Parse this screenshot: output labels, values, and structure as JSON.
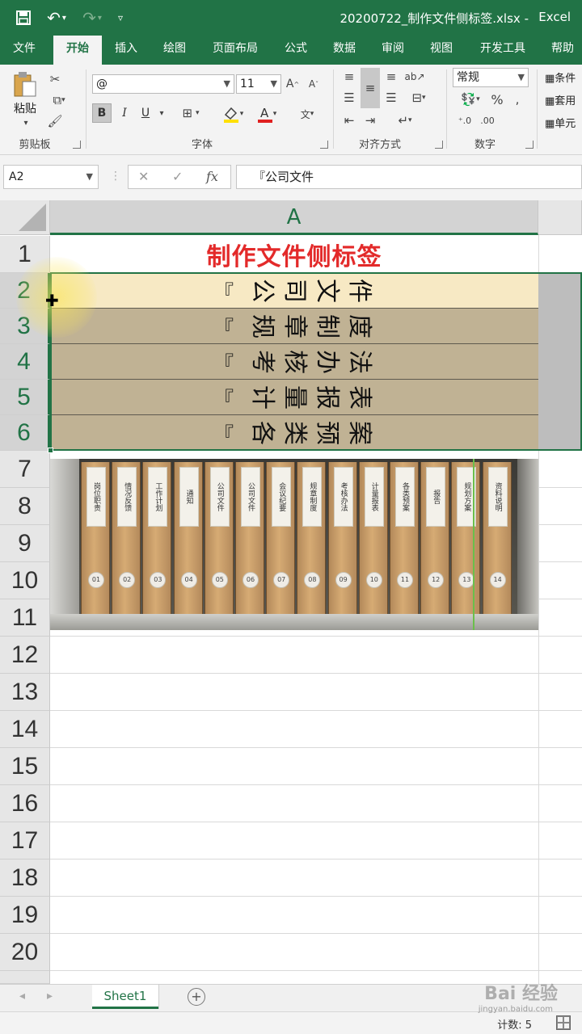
{
  "titlebar": {
    "filename": "20200722_制作文件侧标签.xlsx",
    "separator": "-",
    "app": "Excel",
    "qat": [
      "save-icon",
      "undo-icon",
      "redo-icon",
      "customize-qat-icon"
    ]
  },
  "tabs": [
    "文件",
    "开始",
    "插入",
    "绘图",
    "页面布局",
    "公式",
    "数据",
    "审阅",
    "视图",
    "开发工具",
    "帮助"
  ],
  "active_tab": "开始",
  "ribbon": {
    "clipboard": {
      "paste_label": "粘贴",
      "group_label": "剪贴板"
    },
    "font": {
      "name": "@",
      "size": "11",
      "group_label": "字体"
    },
    "alignment": {
      "group_label": "对齐方式"
    },
    "number": {
      "format": "常规",
      "group_label": "数字",
      "percent": "%"
    },
    "styles": {
      "conditional": "条件",
      "table": "套用",
      "cell": "单元"
    }
  },
  "formula_bar": {
    "cell_ref": "A2",
    "fx": "fx",
    "content": "『公司文件"
  },
  "grid": {
    "column_headers": [
      "A"
    ],
    "row_headers": [
      "1",
      "2",
      "3",
      "4",
      "5",
      "6",
      "7",
      "8",
      "9",
      "10",
      "11",
      "12",
      "13",
      "14",
      "15",
      "16",
      "17",
      "18",
      "19",
      "20"
    ],
    "title": "制作文件侧标签",
    "labels": [
      {
        "bracket": "『",
        "chars": [
          "公",
          "司",
          "文",
          "件"
        ]
      },
      {
        "bracket": "『",
        "chars": [
          "规",
          "章",
          "制",
          "度"
        ]
      },
      {
        "bracket": "『",
        "chars": [
          "考",
          "核",
          "办",
          "法"
        ]
      },
      {
        "bracket": "『",
        "chars": [
          "计",
          "量",
          "报",
          "表"
        ]
      },
      {
        "bracket": "『",
        "chars": [
          "各",
          "类",
          "预",
          "案"
        ]
      }
    ],
    "label_colors": {
      "normal": "#c0b294",
      "active": "#f7e9c4"
    }
  },
  "photo": {
    "binders": [
      {
        "tag": "岗位职责",
        "num": "01"
      },
      {
        "tag": "情况反馈",
        "num": "02"
      },
      {
        "tag": "工作计划",
        "num": "03"
      },
      {
        "tag": "通知",
        "num": "04"
      },
      {
        "tag": "公司文件",
        "num": "05"
      },
      {
        "tag": "公司文件",
        "num": "06"
      },
      {
        "tag": "会议纪要",
        "num": "07"
      },
      {
        "tag": "规章制度",
        "num": "08"
      },
      {
        "tag": "考核办法",
        "num": "09"
      },
      {
        "tag": "计量报表",
        "num": "10"
      },
      {
        "tag": "各类预案",
        "num": "11"
      },
      {
        "tag": "报告",
        "num": "12"
      },
      {
        "tag": "规划方案",
        "num": "13"
      },
      {
        "tag": "资料说明",
        "num": "14"
      }
    ]
  },
  "sheets": [
    "Sheet1"
  ],
  "status": {
    "count": "计数: 5"
  },
  "watermark": {
    "main": "Bai 经验",
    "sub": "jingyan.baidu.com"
  },
  "colors": {
    "accent": "#217346",
    "title_red": "#e32a2a"
  }
}
